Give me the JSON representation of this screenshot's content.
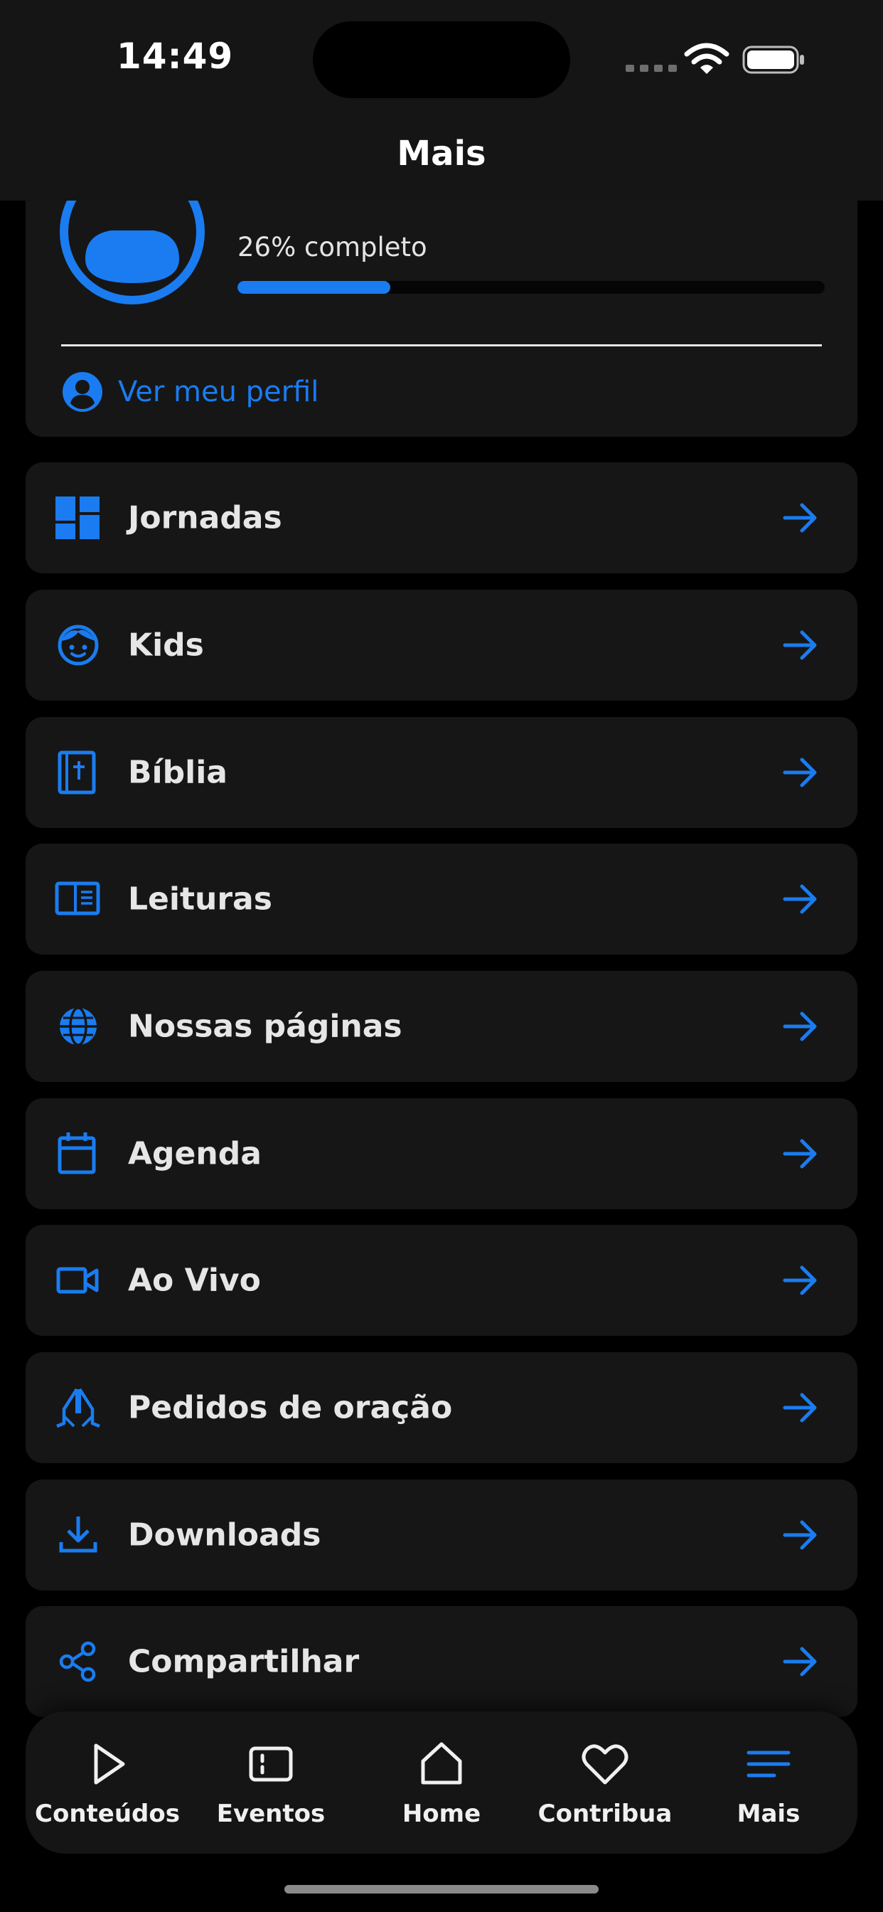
{
  "status_bar": {
    "time": "14:49"
  },
  "header": {
    "title": "Mais"
  },
  "profile": {
    "progress_text": "26% completo",
    "progress_value": 0.26,
    "link_label": "Ver meu perfil"
  },
  "menu": {
    "items": [
      {
        "label": "Jornadas",
        "icon": "dashboard-icon"
      },
      {
        "label": "Kids",
        "icon": "child-face-icon"
      },
      {
        "label": "Bíblia",
        "icon": "bible-icon"
      },
      {
        "label": "Leituras",
        "icon": "book-reader-icon"
      },
      {
        "label": "Nossas páginas",
        "icon": "globe-icon"
      },
      {
        "label": "Agenda",
        "icon": "calendar-icon"
      },
      {
        "label": "Ao Vivo",
        "icon": "video-camera-icon"
      },
      {
        "label": "Pedidos de oração",
        "icon": "praying-hands-icon"
      },
      {
        "label": "Downloads",
        "icon": "download-icon"
      },
      {
        "label": "Compartilhar",
        "icon": "share-icon"
      }
    ]
  },
  "tabbar": {
    "tabs": [
      {
        "label": "Conteúdos",
        "icon": "play-icon"
      },
      {
        "label": "Eventos",
        "icon": "ticket-icon"
      },
      {
        "label": "Home",
        "icon": "home-icon"
      },
      {
        "label": "Contribua",
        "icon": "heart-icon"
      },
      {
        "label": "Mais",
        "icon": "menu-icon"
      }
    ],
    "active": "Mais"
  },
  "colors": {
    "accent": "#1a7cf0",
    "card": "#161616",
    "background": "#000000",
    "text": "#e6e6e6"
  }
}
